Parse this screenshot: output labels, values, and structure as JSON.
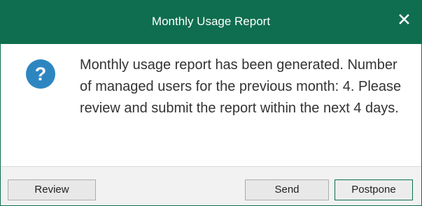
{
  "window": {
    "title": "Monthly Usage Report",
    "close_icon": "close-icon",
    "accent_color": "#0f6e4f"
  },
  "message": {
    "icon": "question-icon",
    "icon_color": "#2e86c1",
    "text": "Monthly usage report has been generated. Number of managed users for the previous month: 4. Please review and submit the report within the next 4 days."
  },
  "buttons": {
    "review_label": "Review",
    "send_label": "Send",
    "postpone_label": "Postpone"
  }
}
